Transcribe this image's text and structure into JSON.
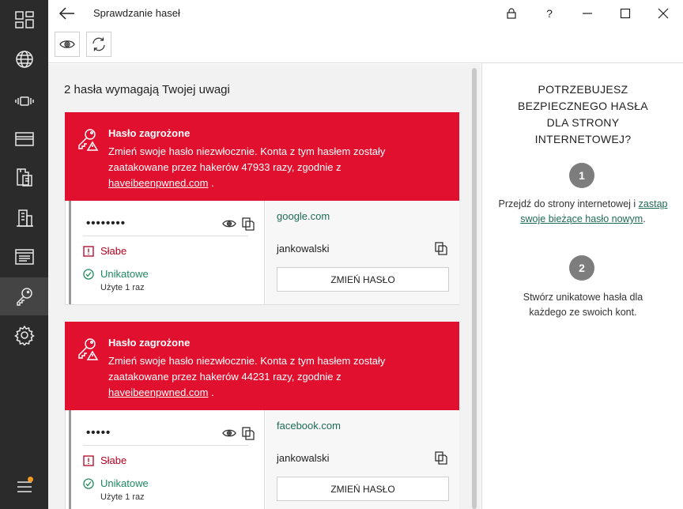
{
  "window": {
    "title": "Sprawdzanie haseł",
    "help_label": "?"
  },
  "rail": {
    "items": [
      {
        "icon": "dashboard-icon"
      },
      {
        "icon": "globe-icon"
      },
      {
        "icon": "vibrate-icon"
      },
      {
        "icon": "card-icon"
      },
      {
        "icon": "documents-icon"
      },
      {
        "icon": "building-icon"
      },
      {
        "icon": "notes-icon"
      },
      {
        "icon": "key-icon",
        "active": true
      },
      {
        "icon": "gear-icon"
      }
    ],
    "menu_icon": "menu-icon",
    "notification_color": "#f59a23"
  },
  "main": {
    "heading": "2 hasła wymagają Twojej uwagi",
    "cards": [
      {
        "alert_title": "Hasło zagrożone",
        "alert_text": "Zmień swoje hasło niezwłocznie. Konta z tym hasłem zostały zaatakowane przez hakerów 47933 razy, zgodnie z ",
        "alert_link": "haveibeenpwned.com",
        "alert_suffix": " .",
        "password_mask": "••••••••",
        "strength": "Słabe",
        "uniqueness": "Unikatowe",
        "used": "Użyte 1 raz",
        "site": "google.com",
        "username": "jankowalski",
        "change_label": "ZMIEŃ HASŁO"
      },
      {
        "alert_title": "Hasło zagrożone",
        "alert_text": "Zmień swoje hasło niezwłocznie. Konta z tym hasłem zostały zaatakowane przez hakerów 44231 razy, zgodnie z ",
        "alert_link": "haveibeenpwned.com",
        "alert_suffix": " .",
        "password_mask": "•••••",
        "strength": "Słabe",
        "uniqueness": "Unikatowe",
        "used": "Użyte 1 raz",
        "site": "facebook.com",
        "username": "jankowalski",
        "change_label": "ZMIEŃ HASŁO"
      }
    ]
  },
  "side": {
    "title_line1": "POTRZEBUJESZ",
    "title_line2": "BEZPIECZNEGO HASŁA",
    "title_line3": "DLA STRONY",
    "title_line4": "INTERNETOWEJ?",
    "step1_number": "1",
    "step1_text": "Przejdź do strony internetowej i ",
    "step1_link": "zastąp swoje bieżące hasło nowym",
    "step1_suffix": ".",
    "step2_number": "2",
    "step2_text": "Stwórz unikatowe hasła dla każdego ze swoich kont."
  },
  "colors": {
    "alert": "#e0102e",
    "accent_green": "#1e6b55",
    "rail": "#2b2b2b"
  }
}
